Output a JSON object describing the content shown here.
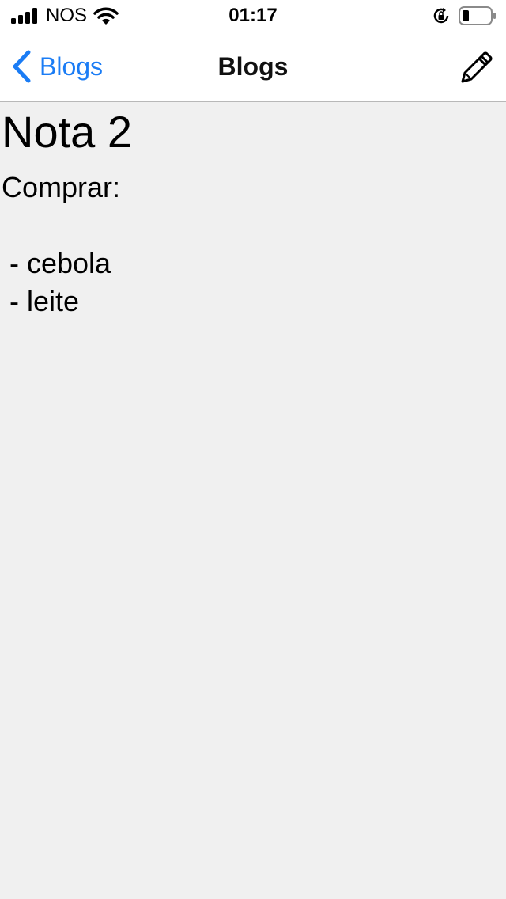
{
  "status_bar": {
    "carrier": "NOS",
    "time": "01:17"
  },
  "nav_bar": {
    "back_label": "Blogs",
    "title": "Blogs",
    "accent_color": "#1a7cf5"
  },
  "note": {
    "title": "Nota 2",
    "body": "Comprar:\n\n - cebola\n - leite"
  },
  "icons": [
    "signal-bars-icon",
    "wifi-icon",
    "orientation-lock-icon",
    "battery-icon",
    "chevron-left-icon",
    "pencil-icon"
  ]
}
